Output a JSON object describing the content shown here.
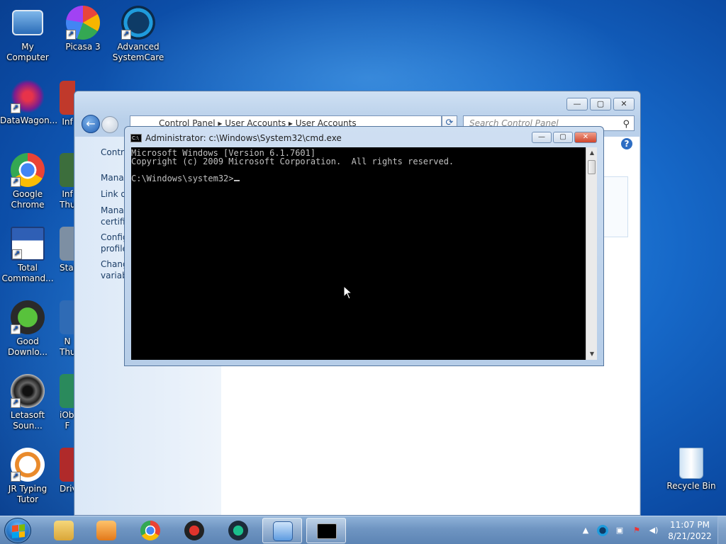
{
  "desktop": {
    "icons": [
      {
        "label": "My Computer"
      },
      {
        "label": "Picasa 3"
      },
      {
        "label": "Advanced SystemCare"
      },
      {
        "label": "DataWagon..."
      },
      {
        "label": "Google Chrome"
      },
      {
        "label": "Total Command..."
      },
      {
        "label": "Good Downlo..."
      },
      {
        "label": "Letasoft Soun..."
      },
      {
        "label": "JR Typing Tutor"
      },
      {
        "label": "Recycle Bin"
      }
    ],
    "partial_labels": [
      "Inf",
      "Inf Thu",
      "Star",
      "N Thu",
      "iObi F",
      "Drive"
    ]
  },
  "explorer": {
    "breadcrumb": "Control Panel  ▸  User Accounts  ▸  User Accounts",
    "search_placeholder": "Search Control Panel",
    "left_tasks": [
      "Contro",
      "Manag",
      "Link o",
      "Manag certific",
      "Config profile",
      "Chang variab"
    ]
  },
  "cmd": {
    "title": "Administrator: c:\\Windows\\System32\\cmd.exe",
    "lines": [
      "Microsoft Windows [Version 6.1.7601]",
      "Copyright (c) 2009 Microsoft Corporation.  All rights reserved.",
      "",
      "C:\\Windows\\system32>"
    ]
  },
  "taskbar": {
    "clock_time": "11:07 PM",
    "clock_date": "8/21/2022"
  },
  "colors": {
    "desktop_blue": "#1668c8",
    "taskbar": "#6f95c2",
    "console_bg": "#000000",
    "console_fg": "#c0c0c0",
    "close_red": "#d0452c"
  }
}
